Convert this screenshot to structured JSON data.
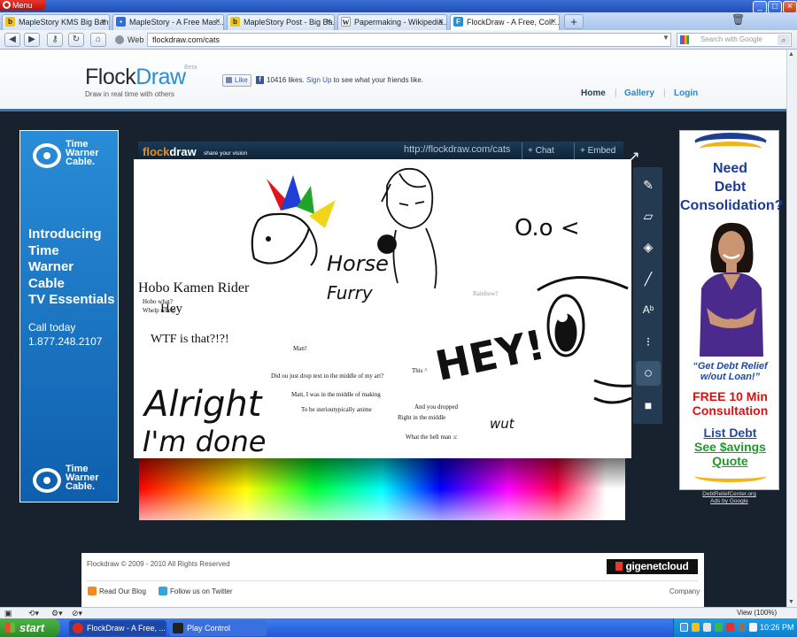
{
  "browser": {
    "menu_label": "Menu",
    "window_buttons": [
      "_",
      "□",
      "×"
    ],
    "tabs": [
      {
        "title": "MapleStory KMS Big Ban...",
        "favicon": "maplestory-icon",
        "favicon_color": "#f2c318"
      },
      {
        "title": "MapleStory - A Free Mas...",
        "favicon": "nexon-icon",
        "favicon_color": "#2d6fd6"
      },
      {
        "title": "MapleStory Post - Big Ba...",
        "favicon": "maplestory-icon",
        "favicon_color": "#f2c318"
      },
      {
        "title": "Papermaking - Wikipedia...",
        "favicon": "wikipedia-icon",
        "favicon_color": "#ffffff"
      },
      {
        "title": "FlockDraw - A Free, Coll...",
        "favicon": "flockdraw-icon",
        "favicon_color": "#2a8fd0",
        "active": true
      }
    ],
    "new_tab": "+",
    "web_label": "Web",
    "url": "flockdraw.com/cats",
    "search_placeholder": "Search with Google",
    "zoom": "View (100%)"
  },
  "site": {
    "logo_flock": "Flock",
    "logo_draw": "Draw",
    "beta": "Beta",
    "tagline": "Draw in real time with others",
    "like_button": "Like",
    "like_count": "10416 likes.",
    "signup_link": "Sign Up",
    "like_suffix": "to see what your friends like.",
    "nav": [
      "Home",
      "Gallery",
      "Login"
    ]
  },
  "ad_left": {
    "brand_lines": [
      "Time",
      "Warner",
      "Cable."
    ],
    "headline_lines": [
      "Introducing",
      "Time",
      "Warner",
      "Cable",
      "TV Essentials"
    ],
    "call_lines": [
      "Call today",
      "1.877.248.2107"
    ]
  },
  "ad_right": {
    "need_lines": [
      "Need",
      "Debt",
      "Consolidation?"
    ],
    "quote_lines": [
      "“Get Debt Relief",
      "w/out Loan!”"
    ],
    "free_lines": [
      "FREE 10 Min",
      "Consultation"
    ],
    "list_debt": "List Debt",
    "see_savings": "See $avings",
    "quote": "Quote",
    "url_lines": [
      "DebtReliefCenter.org",
      "Ads by Google"
    ]
  },
  "app": {
    "logo_flock": "flock",
    "logo_draw": "draw",
    "slogan": "share your vision",
    "room_url": "http://flockdraw.com/cats",
    "chat_button": "+ Chat",
    "embed_button": "+ Embed",
    "tools": [
      "pencil-tool",
      "eraser-tool",
      "fill-tool",
      "line-tool",
      "text-tool",
      "brush-size-tool",
      "circle-tool",
      "square-tool"
    ],
    "canvas_texts": [
      {
        "text": "Hobo Kamen Rider",
        "size": 16
      },
      {
        "text": "Hobo what?",
        "size": 7
      },
      {
        "text": "Whelp whelp",
        "size": 7
      },
      {
        "text": "Hey",
        "size": 15
      },
      {
        "text": "WTF is that?!?!",
        "size": 14
      },
      {
        "text": "Matt!",
        "size": 7
      },
      {
        "text": "Did ou just drop text in the middle of my art?",
        "size": 7
      },
      {
        "text": "Matt, I was in the middle of making",
        "size": 7
      },
      {
        "text": "To be sterioutypically anime",
        "size": 7
      },
      {
        "text": "This ^",
        "size": 7
      },
      {
        "text": "And you dropped",
        "size": 7
      },
      {
        "text": "Right in the middle",
        "size": 7
      },
      {
        "text": "What the hell man :c",
        "size": 7
      },
      {
        "text": "Rainbow?",
        "size": 7
      }
    ],
    "handwriting": [
      "Horse",
      "Furry",
      "Alright",
      "I'm done",
      "O.o <",
      "HEY!",
      "wut"
    ]
  },
  "footer": {
    "copyright": "Flockdraw © 2009 - 2010 All Rights Reserved",
    "sponsor": "gigenetcloud",
    "blog": "Read Our Blog",
    "twitter": "Follow us on Twitter",
    "company": "Company"
  },
  "taskbar": {
    "start": "start",
    "tasks": [
      "FlockDraw - A Free, ...",
      "Play Control"
    ],
    "clock": "10:26 PM"
  }
}
